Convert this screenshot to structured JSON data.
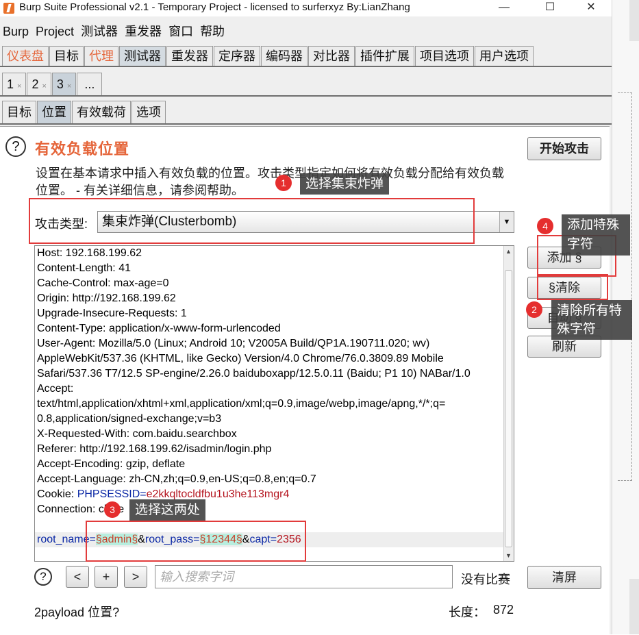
{
  "window": {
    "title": "Burp Suite Professional v2.1 - Temporary Project - licensed to surferxyz By:LianZhang",
    "minimize": "—",
    "maximize": "☐",
    "close": "✕"
  },
  "menu": [
    "Burp",
    "Project",
    "测试器",
    "重发器",
    "窗口",
    "帮助"
  ],
  "main_tabs": [
    {
      "label": "仪表盘",
      "orange": true
    },
    {
      "label": "目标"
    },
    {
      "label": "代理",
      "orange": true
    },
    {
      "label": "测试器",
      "active": true
    },
    {
      "label": "重发器"
    },
    {
      "label": "定序器"
    },
    {
      "label": "编码器"
    },
    {
      "label": "对比器"
    },
    {
      "label": "插件扩展"
    },
    {
      "label": "项目选项"
    },
    {
      "label": "用户选项"
    }
  ],
  "attack_tabs": {
    "items": [
      "1",
      "2",
      "3"
    ],
    "close_glyph": "×",
    "more": "..."
  },
  "sub_tabs": [
    "目标",
    "位置",
    "有效载荷",
    "选项"
  ],
  "positions": {
    "help_glyph": "?",
    "heading": "有效负载位置",
    "description": "设置在基本请求中插入有效负载的位置。攻击类型指定如何将有效负载分配给有效负载位置。 - 有关详细信息，请参阅帮助。",
    "start_attack": "开始攻击",
    "attack_type_label": "攻击类型:",
    "attack_type_value": "集束炸弹(Clusterbomb)",
    "buttons": {
      "add": "添加 §",
      "clear": "§清除",
      "auto": "自动 §",
      "refresh": "刷新"
    }
  },
  "request": {
    "headers": [
      "Host: 192.168.199.62",
      "Content-Length: 41",
      "Cache-Control: max-age=0",
      "Origin: http://192.168.199.62",
      "Upgrade-Insecure-Requests: 1",
      "Content-Type: application/x-www-form-urlencoded",
      "User-Agent: Mozilla/5.0 (Linux; Android 10; V2005A Build/QP1A.190711.020; wv)",
      "AppleWebKit/537.36 (KHTML, like Gecko) Version/4.0 Chrome/76.0.3809.89 Mobile",
      "Safari/537.36 T7/12.5 SP-engine/2.26.0 baiduboxapp/12.5.0.11 (Baidu; P1 10) NABar/1.0",
      "Accept:",
      "text/html,application/xhtml+xml,application/xml;q=0.9,image/webp,image/apng,*/*;q=",
      "0.8,application/signed-exchange;v=b3",
      "X-Requested-With: com.baidu.searchbox",
      "Referer: http://192.168.199.62/isadmin/login.php",
      "Accept-Encoding: gzip, deflate",
      "Accept-Language: zh-CN,zh;q=0.9,en-US;q=0.8,en;q=0.7"
    ],
    "cookie_label": "Cookie: ",
    "cookie_key": "PHPSESSID",
    "cookie_eq": "=",
    "cookie_value": "e2kkqltocldfbu1u3he113mgr4",
    "connection_label": "Connection: ",
    "connection_value": "close",
    "body": {
      "k1": "root_name",
      "eq1": "=",
      "v1": "§admin§",
      "amp1": "&",
      "k2": "root_pass",
      "eq2": "=",
      "v2": "§12344§",
      "amp2": "&",
      "k3": "capt",
      "eq3": "=",
      "v3": "2356"
    }
  },
  "search": {
    "help_glyph": "?",
    "prev": "<",
    "plus": "+",
    "next": ">",
    "placeholder": "输入搜索字词",
    "match": "没有比赛",
    "clear": "清屏"
  },
  "status": {
    "positions": "2payload 位置?",
    "length_label": "长度：",
    "length_value": "872"
  },
  "annotations": [
    {
      "n": "1",
      "text": "选择集束炸弹"
    },
    {
      "n": "2",
      "text": "清除所有特殊字符"
    },
    {
      "n": "3",
      "text": "选择这两处"
    },
    {
      "n": "4",
      "text": "添加特殊字符"
    }
  ],
  "colors": {
    "accent_orange": "#e5653a",
    "annotation_red": "#e23b3b",
    "param_key_blue": "#0a27a5",
    "payload_bg": "#b8eedf"
  }
}
